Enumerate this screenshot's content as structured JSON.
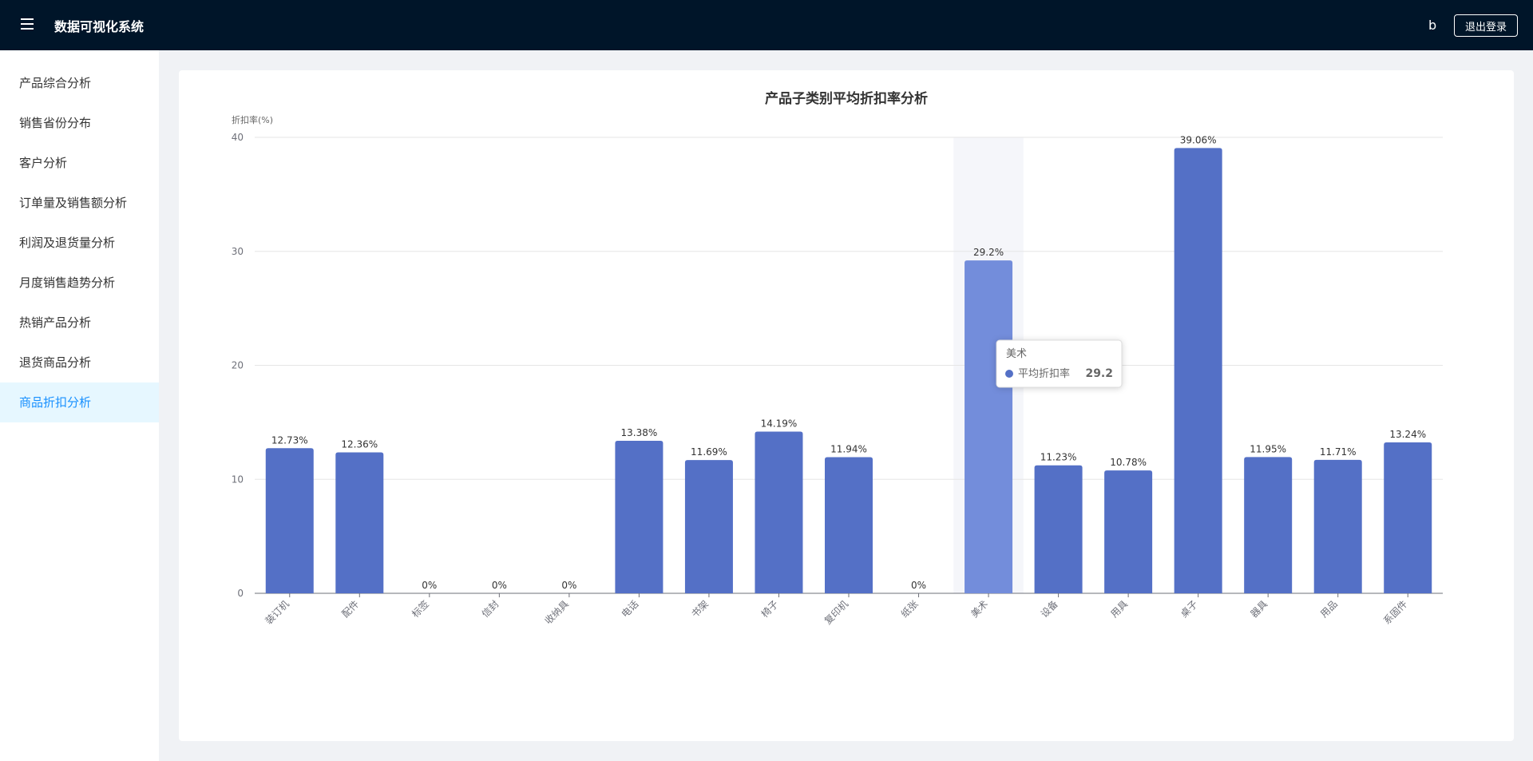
{
  "header": {
    "app_title": "数据可视化系统",
    "username": "b",
    "logout_label": "退出登录",
    "menu_icon": "hamburger-icon"
  },
  "sidebar": {
    "items": [
      {
        "label": "产品综合分析"
      },
      {
        "label": "销售省份分布"
      },
      {
        "label": "客户分析"
      },
      {
        "label": "订单量及销售额分析"
      },
      {
        "label": "利润及退货量分析"
      },
      {
        "label": "月度销售趋势分析"
      },
      {
        "label": "热销产品分析"
      },
      {
        "label": "退货商品分析"
      },
      {
        "label": "商品折扣分析"
      }
    ],
    "active_index": 8
  },
  "chart_data": {
    "type": "bar",
    "title": "产品子类别平均折扣率分析",
    "ylabel": "折扣率(%)",
    "xlabel": "",
    "ylim": [
      0,
      40
    ],
    "yticks": [
      0,
      10,
      20,
      30,
      40
    ],
    "grid": true,
    "categories": [
      "装订机",
      "配件",
      "标签",
      "信封",
      "收纳具",
      "电话",
      "书架",
      "椅子",
      "复印机",
      "纸张",
      "美术",
      "设备",
      "用具",
      "桌子",
      "器具",
      "用品",
      "系固件"
    ],
    "series": [
      {
        "name": "平均折扣率",
        "values": [
          12.73,
          12.36,
          0,
          0,
          0,
          13.38,
          11.69,
          14.19,
          11.94,
          0,
          29.2,
          11.23,
          10.78,
          39.06,
          11.95,
          11.71,
          13.24
        ],
        "labels": [
          "12.73%",
          "12.36%",
          "0%",
          "0%",
          "0%",
          "13.38%",
          "11.69%",
          "14.19%",
          "11.94%",
          "0%",
          "29.2%",
          "11.23%",
          "10.78%",
          "39.06%",
          "11.95%",
          "11.71%",
          "13.24%"
        ]
      }
    ],
    "bar_color": "#5470c6",
    "highlight_color": "#738ddb",
    "tooltip": {
      "category": "美术",
      "series_name": "平均折扣率",
      "value": "29.2"
    }
  }
}
